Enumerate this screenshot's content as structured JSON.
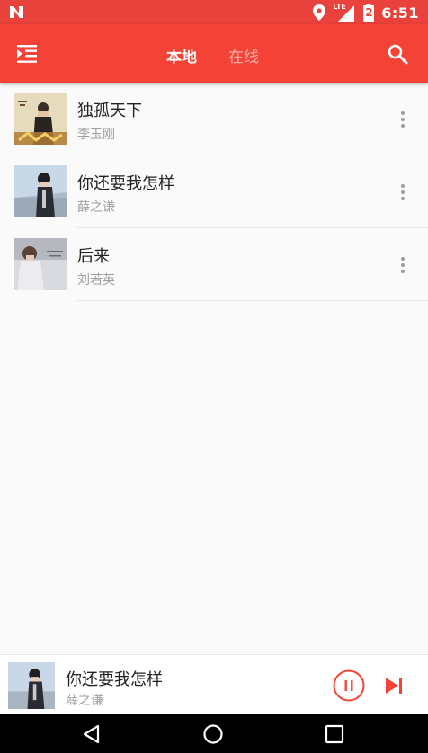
{
  "status_bar": {
    "time": "6:51",
    "network": "LTE",
    "battery_level": "2",
    "icons": [
      "n-icon",
      "location-icon",
      "signal-icon",
      "battery-icon"
    ]
  },
  "app_bar": {
    "tabs": [
      {
        "label": "本地",
        "active": true
      },
      {
        "label": "在线",
        "active": false
      }
    ],
    "icons": [
      "menu-icon",
      "search-icon"
    ],
    "color": "#f44336"
  },
  "songs": [
    {
      "title": "独孤天下",
      "artist": "李玉刚"
    },
    {
      "title": "你还要我怎样",
      "artist": "薛之谦"
    },
    {
      "title": "后来",
      "artist": "刘若英"
    }
  ],
  "now_playing": {
    "title": "你还要我怎样",
    "artist": "薛之谦",
    "state": "playing",
    "accent": "#f44336"
  },
  "nav_bar": {
    "icons": [
      "back-icon",
      "home-icon",
      "recents-icon"
    ]
  }
}
